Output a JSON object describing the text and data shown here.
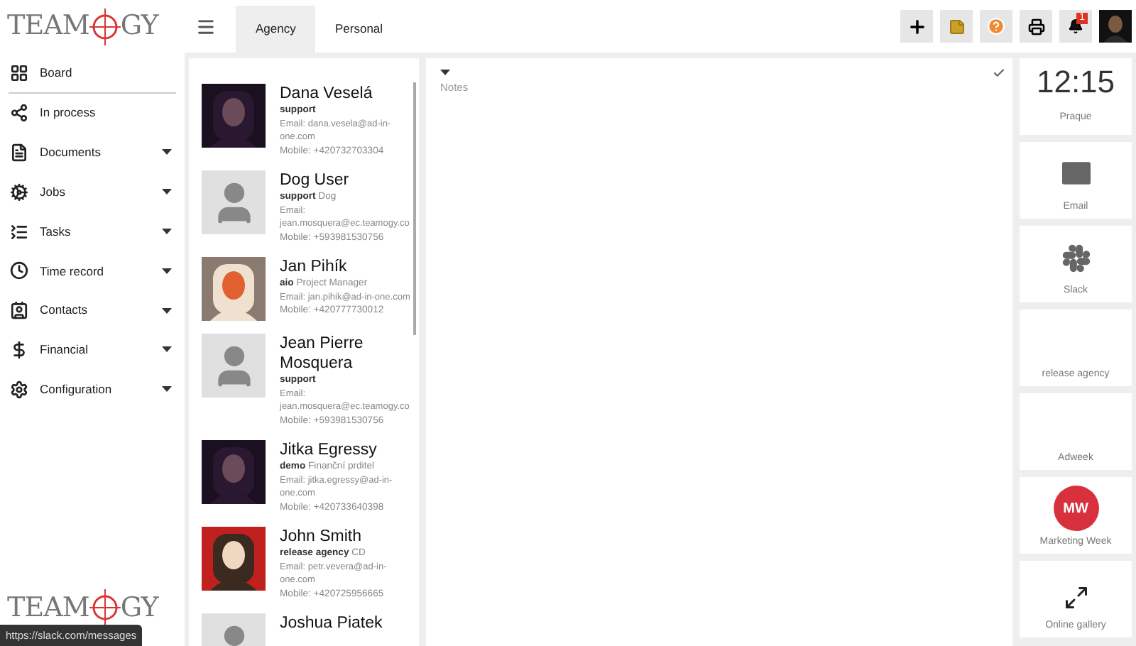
{
  "logos": [
    {
      "left": "TEAM",
      "right": "GY"
    },
    {
      "left": "TEAM",
      "right": "GY"
    }
  ],
  "sidebar": {
    "items": [
      {
        "kind": "grid",
        "label": "Board",
        "expandable": false,
        "divider": true
      },
      {
        "kind": "process",
        "label": "In process",
        "expandable": false,
        "divider": false
      },
      {
        "kind": "document",
        "label": "Documents",
        "expandable": true,
        "divider": false
      },
      {
        "kind": "jobs",
        "label": "Jobs",
        "expandable": true,
        "divider": false
      },
      {
        "kind": "tasks",
        "label": "Tasks",
        "expandable": true,
        "divider": false
      },
      {
        "kind": "clock",
        "label": "Time record",
        "expandable": true,
        "divider": false
      },
      {
        "kind": "contacts",
        "label": "Contacts",
        "expandable": true,
        "divider": false
      },
      {
        "kind": "dollar",
        "label": "Financial",
        "expandable": true,
        "divider": false
      },
      {
        "kind": "gear",
        "label": "Configuration",
        "expandable": true,
        "divider": false
      }
    ]
  },
  "tabs": [
    {
      "label": "Agency",
      "selected": true
    },
    {
      "label": "Personal",
      "selected": false
    }
  ],
  "toolbar": [
    {
      "kind": "plus"
    },
    {
      "kind": "note"
    },
    {
      "kind": "help"
    },
    {
      "kind": "print"
    },
    {
      "kind": "bell",
      "badge": "1"
    },
    {
      "kind": "avatar"
    }
  ],
  "contacts": [
    {
      "name": "Dana Veselá",
      "role": "support",
      "email": "Email: dana.vesela@ad-in-one.com",
      "mobile": "Mobile: +420732703304"
    },
    {
      "kind": "placeholder",
      "name": "Dog User",
      "role": "support",
      "title": "Dog",
      "email": "Email: jean.mosquera@ec.teamogy.co",
      "mobile": "Mobile: +593981530756"
    },
    {
      "name": "Jan Pihík",
      "role": "aio",
      "title": "Project Manager",
      "email": "Email: jan.pihik@ad-in-one.com",
      "mobile": "Mobile: +420777730012"
    },
    {
      "kind": "placeholder",
      "name": "Jean Pierre Mosquera",
      "role": "support",
      "email": "Email: jean.mosquera@ec.teamogy.co",
      "mobile": "Mobile: +593981530756"
    },
    {
      "name": "Jitka Egressy",
      "role": "demo",
      "title": "Finanční prditel",
      "email": "Email: jitka.egressy@ad-in-one.com",
      "mobile": "Mobile: +420733640398"
    },
    {
      "name": "John Smith",
      "role": "release agency",
      "title": "CD",
      "email": "Email: petr.vevera@ad-in-one.com",
      "mobile": "Mobile: +420725956665"
    },
    {
      "kind": "placeholder",
      "name": "Joshua Piatek"
    }
  ],
  "notes": {
    "placeholder": "Notes"
  },
  "tiles": [
    {
      "kind": "clock",
      "time": "12:15",
      "label": "Praque"
    },
    {
      "kind": "email",
      "label": "Email"
    },
    {
      "kind": "slack",
      "label": "Slack"
    },
    {
      "kind": "blank",
      "label": "release agency"
    },
    {
      "kind": "blank",
      "label": "Adweek"
    },
    {
      "kind": "badge",
      "badge": "MW",
      "label": "Marketing Week"
    },
    {
      "kind": "expand",
      "label": "Online gallery"
    }
  ],
  "status_bar": {
    "url": "https://slack.com/messages"
  }
}
